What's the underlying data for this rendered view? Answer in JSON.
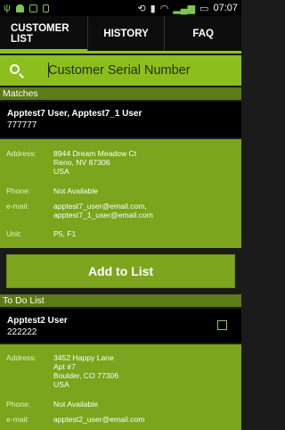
{
  "status_bar": {
    "time": "07:07"
  },
  "tabs": [
    "CUSTOMER\nLIST",
    "HISTORY",
    "FAQ"
  ],
  "search": {
    "placeholder": "Customer Serial Number",
    "value": ""
  },
  "matches": {
    "heading": "Matches",
    "customer": {
      "name": "Apptest7 User, Apptest7_1 User",
      "serial": "777777",
      "address_label": "Address:",
      "address": [
        "8944 Dream Meadow Ct",
        "Reno, NV 87306",
        "USA"
      ],
      "phone_label": "Phone:",
      "phone": "Not Available",
      "email_label": "e-mail:",
      "email": [
        "apptest7_user@email.com,",
        "apptest7_1_user@email.com"
      ],
      "unit_label": "Unit:",
      "unit": "P5, F1"
    },
    "add_button": "Add to List"
  },
  "todo": {
    "heading": "To Do List",
    "customer": {
      "name": "Apptest2 User",
      "serial": "222222",
      "address_label": "Address:",
      "address": [
        "3452 Happy Lane",
        "Apt #7",
        "Boulder, CO 77306",
        "USA"
      ],
      "phone_label": "Phone:",
      "phone": "Not Available",
      "email_label": "e-mail:",
      "email": [
        "apptest2_user@email.com"
      ]
    }
  }
}
